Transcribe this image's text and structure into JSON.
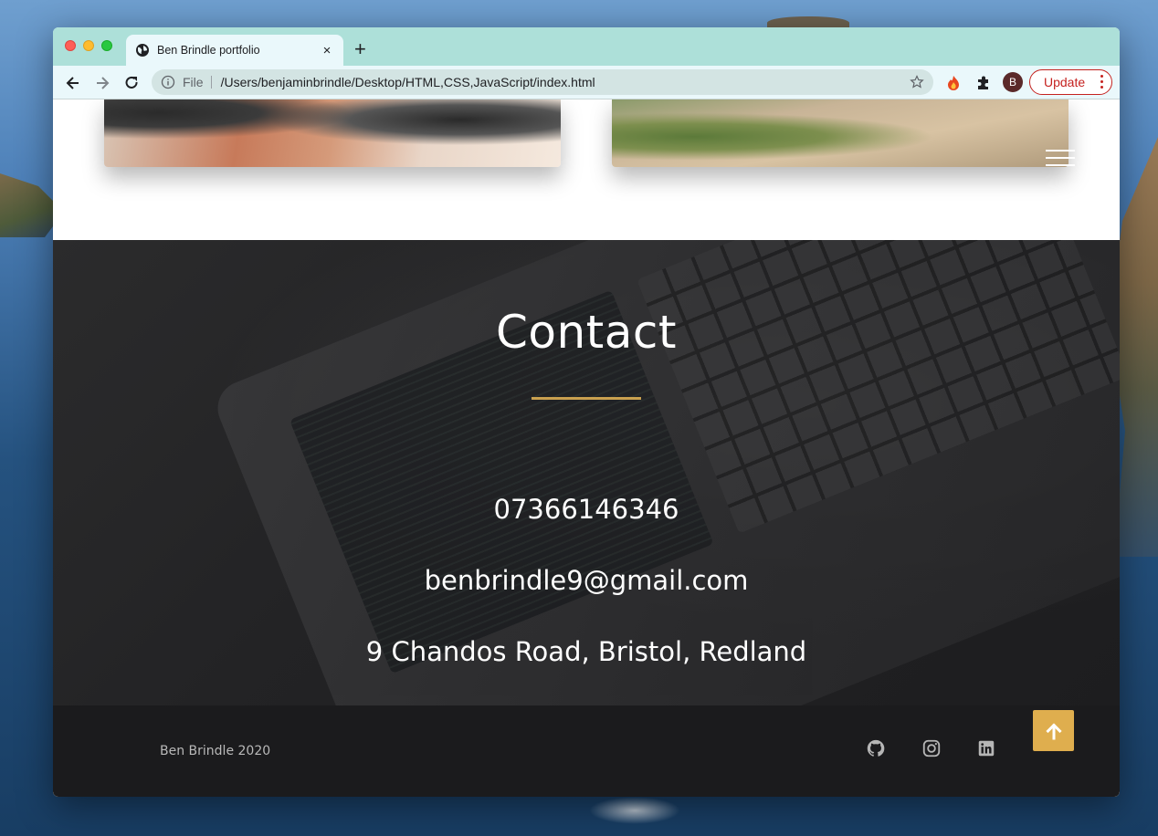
{
  "browser": {
    "tab_title": "Ben Brindle portfolio",
    "tab_close": "×",
    "new_tab": "+",
    "url_scheme": "File",
    "url_path": "/Users/benjaminbrindle/Desktop/HTML,CSS,JavaScript/index.html",
    "profile_initial": "B",
    "update_label": "Update"
  },
  "contact": {
    "title": "Contact",
    "phone": "07366146346",
    "email": "benbrindle9@gmail.com",
    "address": "9 Chandos Road, Bristol, Redland"
  },
  "footer": {
    "copyright": "Ben Brindle 2020",
    "social_icons": [
      "github-icon",
      "instagram-icon",
      "linkedin-icon"
    ]
  },
  "colors": {
    "tabbar": "#ade0d9",
    "accent_gold": "#dfae4e",
    "update_red": "#c5221f",
    "footer_bg": "#1b1b1d"
  }
}
